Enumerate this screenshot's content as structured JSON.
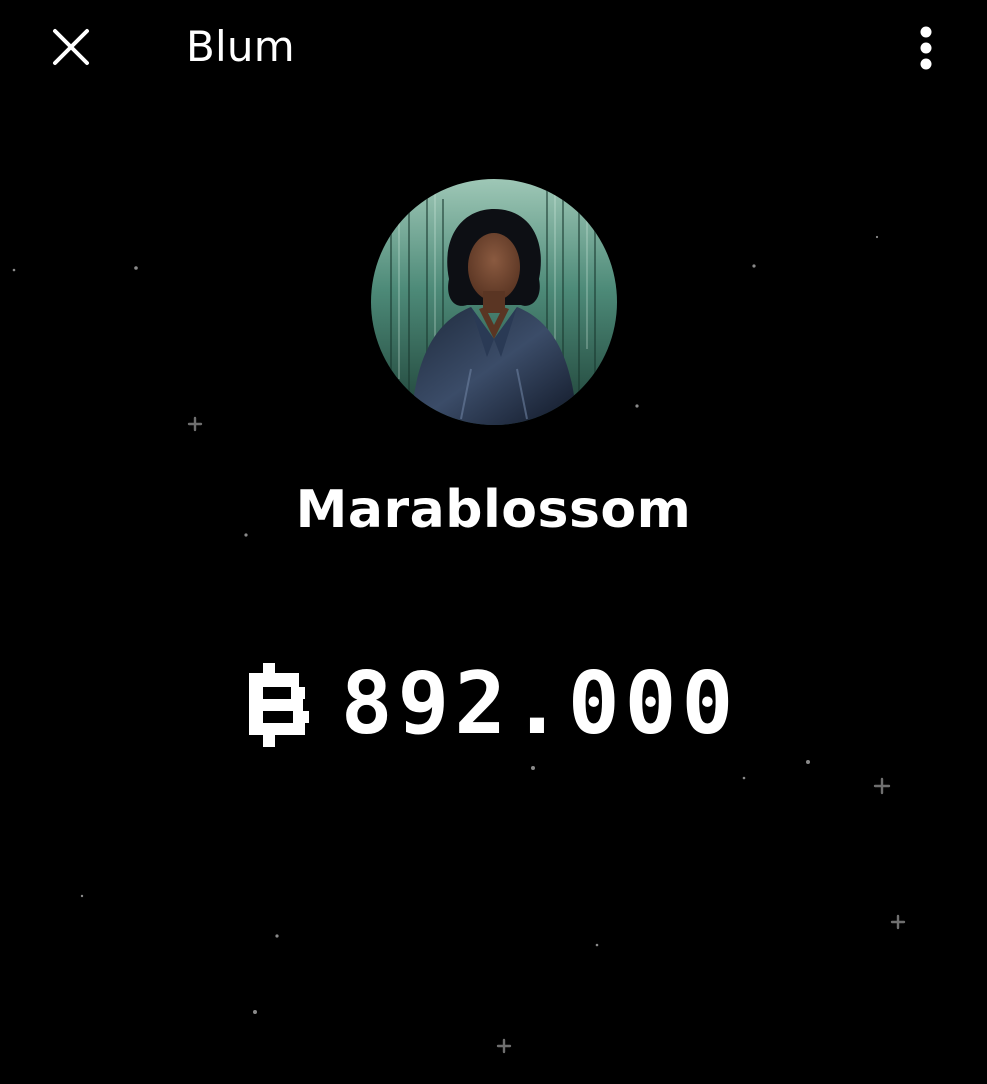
{
  "header": {
    "close_icon": "close-icon",
    "title": "Blum",
    "menu_icon": "more-vertical-icon"
  },
  "profile": {
    "avatar_icon": "profile-avatar",
    "username": "Marablossom"
  },
  "balance": {
    "currency_icon": "blum-points-icon",
    "value": "892.000"
  },
  "colors": {
    "background": "#000000",
    "text": "#ffffff",
    "star": "#7a7a7a"
  }
}
